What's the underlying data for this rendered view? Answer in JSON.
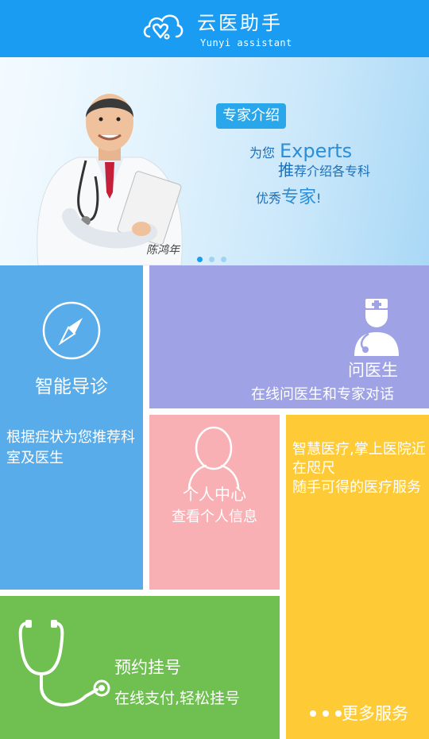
{
  "header": {
    "title": "云医助手",
    "subtitle": "Yunyi assistant",
    "logo_icon": "cloud-heart-logo"
  },
  "banner": {
    "badge": "专家介绍",
    "line1_prefix": "为您",
    "line1_word": "Experts",
    "line2_big": "推",
    "line2_rest": "荐介绍各专科",
    "line3_prefix": "优秀",
    "line3_big": "专家",
    "line3_suffix": "!",
    "signature": "陈鸿年",
    "slides": 3,
    "active_slide": 1
  },
  "tiles": {
    "guide": {
      "title": "智能导诊",
      "desc": "根据症状为您推荐科室及医生",
      "icon": "compass-icon",
      "color": "#58acea"
    },
    "doctor": {
      "title": "问医生",
      "desc": "在线问医生和专家对话",
      "icon": "doctor-icon",
      "color": "#9fa3e5"
    },
    "profile": {
      "title": "个人中心",
      "desc": "查看个人信息",
      "icon": "person-icon",
      "color": "#f9b0b5"
    },
    "more": {
      "text1": "智慧医疗,掌上医院近在咫尺",
      "text2": "随手可得的医疗服务",
      "label": "更多服务",
      "color": "#fecb36"
    },
    "register": {
      "title": "预约挂号",
      "desc": "在线支付,轻松挂号",
      "icon": "stethoscope-icon",
      "color": "#6fbf51"
    }
  },
  "colors": {
    "header": "#1a9cf3"
  }
}
